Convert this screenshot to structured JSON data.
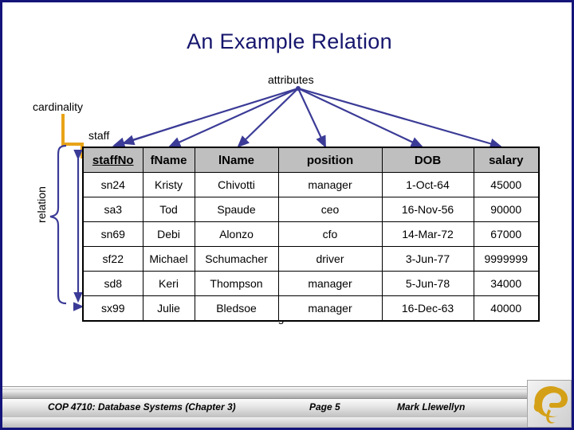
{
  "slide": {
    "title": "An Example Relation",
    "border_color": "#14147a",
    "title_color": "#16166e",
    "background": "#ffffff"
  },
  "annotations": {
    "attributes": "attributes",
    "cardinality": "cardinality",
    "relation": "relation",
    "degree": "degree",
    "table_name": "staff",
    "arrow_color": "#3b3b97",
    "cardinality_line_color": "#e8a317"
  },
  "table": {
    "columns": [
      {
        "label": "staffNo",
        "primary_key": true
      },
      {
        "label": "fName",
        "primary_key": false
      },
      {
        "label": "lName",
        "primary_key": false
      },
      {
        "label": "position",
        "primary_key": false
      },
      {
        "label": "DOB",
        "primary_key": false
      },
      {
        "label": "salary",
        "primary_key": false
      }
    ],
    "header_background": "#bfbfbf",
    "rows": [
      [
        "sn24",
        "Kristy",
        "Chivotti",
        "manager",
        "1-Oct-64",
        "45000"
      ],
      [
        "sa3",
        "Tod",
        "Spaude",
        "ceo",
        "16-Nov-56",
        "90000"
      ],
      [
        "sn69",
        "Debi",
        "Alonzo",
        "cfo",
        "14-Mar-72",
        "67000"
      ],
      [
        "sf22",
        "Michael",
        "Schumacher",
        "driver",
        "3-Jun-77",
        "9999999"
      ],
      [
        "sd8",
        "Keri",
        "Thompson",
        "manager",
        "5-Jun-78",
        "34000"
      ],
      [
        "sx99",
        "Julie",
        "Bledsoe",
        "manager",
        "16-Dec-63",
        "40000"
      ]
    ]
  },
  "footer": {
    "course": "COP 4710: Database Systems  (Chapter 3)",
    "page": "Page 5",
    "author": "Mark Llewellyn",
    "logo": "pegasus-logo",
    "logo_color": "#d4a017"
  }
}
